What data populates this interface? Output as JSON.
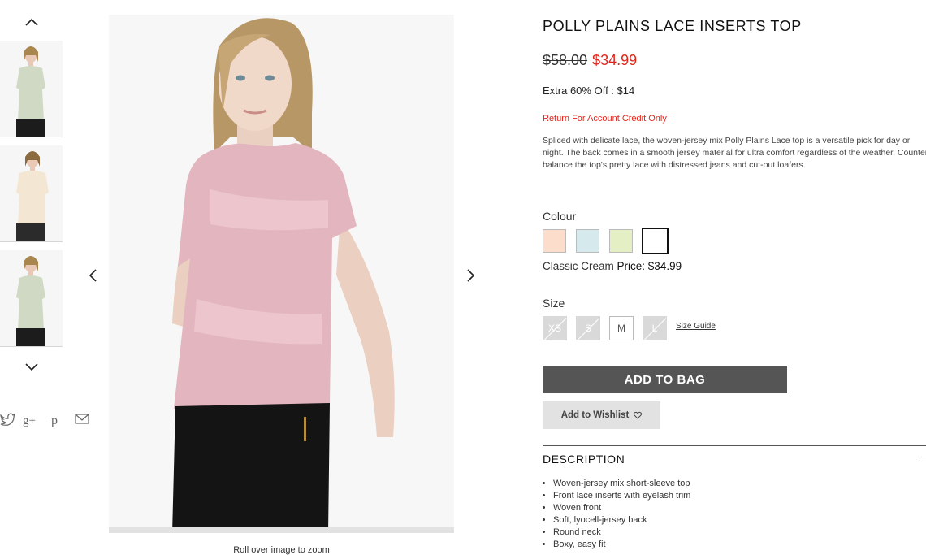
{
  "product": {
    "title": "POLLY PLAINS LACE INSERTS TOP",
    "old_price": "$58.00",
    "new_price": "$34.99",
    "extra_offer": "Extra 60% Off : $14",
    "return_policy": "Return For Account Credit Only",
    "description": "Spliced with delicate lace, the woven-jersey mix Polly Plains Lace top is a versatile pick for day or night. The back comes in a smooth jersey material for ultra comfort regardless of the weather. Counter-balance the top's pretty lace with distressed jeans and cut-out loafers."
  },
  "colour": {
    "label": "Colour",
    "selected_name": "Classic Cream",
    "price_label": "Price: $34.99",
    "swatches": [
      "#fcdccb",
      "#d6eaee",
      "#e5efc4",
      "#ffffff"
    ]
  },
  "size": {
    "label": "Size",
    "options": [
      {
        "label": "XS",
        "available": false
      },
      {
        "label": "S",
        "available": false
      },
      {
        "label": "M",
        "available": true
      },
      {
        "label": "L",
        "available": false
      }
    ],
    "guide_label": "Size Guide"
  },
  "actions": {
    "add_to_bag": "ADD TO BAG",
    "wishlist": "Add to Wishlist",
    "wishlist_icon": "heart-icon"
  },
  "details": {
    "heading": "DESCRIPTION",
    "toggle": "–",
    "bullets": [
      "Woven-jersey mix short-sleeve top",
      "Front lace inserts with eyelash trim",
      "Woven front",
      "Soft, lyocell-jersey back",
      "Round neck",
      "Boxy, easy fit"
    ]
  },
  "gallery": {
    "zoom_hint": "Roll over image to zoom",
    "thumb_up_icon": "chevron-up-icon",
    "thumb_down_icon": "chevron-down-icon",
    "prev_icon": "chevron-left-icon",
    "next_icon": "chevron-right-icon"
  },
  "social": [
    "twitter-icon",
    "google-plus-icon",
    "pinterest-icon",
    "email-icon"
  ],
  "colors": {
    "sale_red": "#e1251b",
    "button_dark": "#555555",
    "button_light": "#e2e2e2"
  }
}
